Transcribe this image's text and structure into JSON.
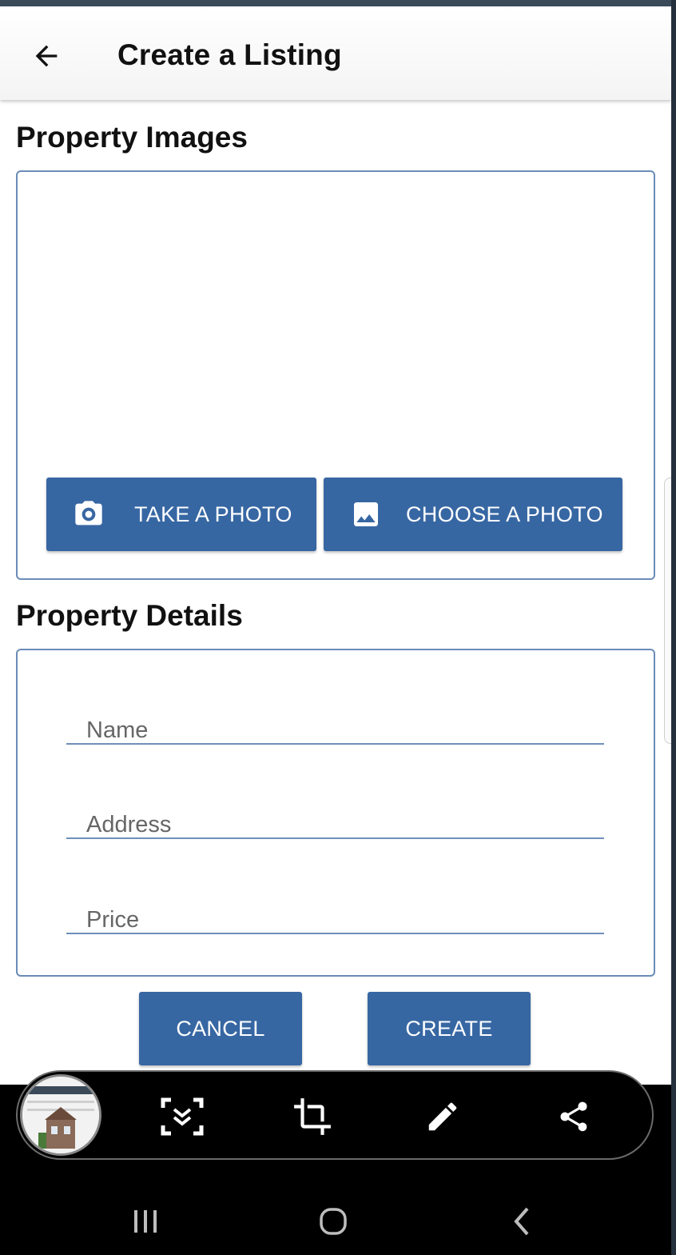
{
  "app_bar": {
    "title": "Create a Listing",
    "back_icon": "arrow-left-icon"
  },
  "images_section": {
    "title": "Property Images",
    "take_photo": {
      "label": "TAKE A PHOTO",
      "icon": "camera-icon"
    },
    "choose_photo": {
      "label": "CHOOSE A PHOTO",
      "icon": "image-icon"
    }
  },
  "details_section": {
    "title": "Property Details",
    "fields": {
      "name": {
        "placeholder": "Name",
        "value": ""
      },
      "address": {
        "placeholder": "Address",
        "value": ""
      },
      "price": {
        "placeholder": "Price",
        "value": ""
      }
    }
  },
  "actions": {
    "cancel_label": "CANCEL",
    "create_label": "CREATE"
  },
  "screenshot_toolbar": {
    "tools": [
      "scroll-capture-icon",
      "crop-icon",
      "pencil-icon",
      "share-icon"
    ]
  },
  "system_nav": {
    "buttons": [
      "recents-icon",
      "home-icon",
      "back-icon"
    ]
  },
  "colors": {
    "primary": "#3767a3",
    "outline": "#6b8cb8",
    "toolbar_bg": "#000000"
  }
}
